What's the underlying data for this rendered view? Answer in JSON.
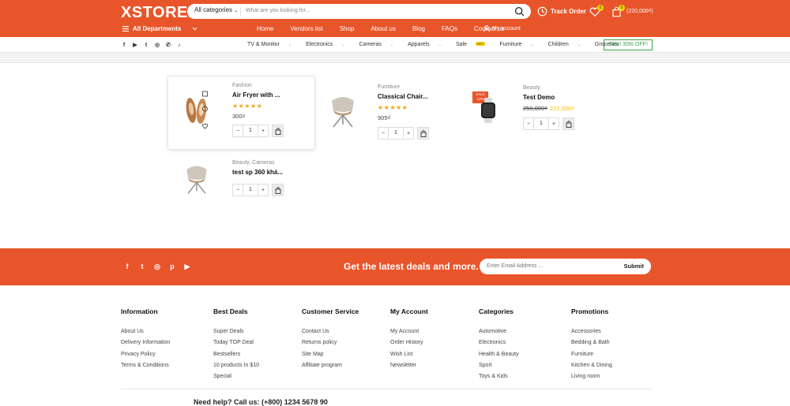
{
  "brand": {
    "logo": "XSTORE."
  },
  "search": {
    "category": "All categories",
    "placeholder": "What are you looking for..."
  },
  "header": {
    "track_order": "Track Order",
    "wishlist_count": "0",
    "cart_count": "0",
    "cart_total": "(220,000₫)",
    "all_departments": "All Departments",
    "nav": [
      "Home",
      "Vendors list",
      "Shop",
      "About us",
      "Blog",
      "FAQs",
      "Contact us"
    ],
    "my_account": "My account"
  },
  "categories": [
    "TV & Monitor",
    "Electronics",
    "Cameras",
    "Apparels",
    "Sale",
    "Furniture",
    "Children",
    "Groceries"
  ],
  "hot_badge": "HOT",
  "sale_banner": "Sale! 30% OFF!",
  "products": [
    {
      "category": "Fashion",
      "title": "Air Fryer with ...",
      "stars": "★★★★★",
      "price": "300₫",
      "qty": "1"
    },
    {
      "category": "Furniture",
      "title": "Classical Chair...",
      "stars": "★★★★★",
      "price": "905₫",
      "qty": "1"
    },
    {
      "category": "Beauty",
      "title": "Test Demo",
      "price_old": "250,000₫",
      "price_new": "222,000₫",
      "qty": "1",
      "sale_tag": "SALE",
      "sale_pct": "12%"
    },
    {
      "category": "Beauty, Cameras",
      "title": "test sp 360 khá...",
      "qty": "1"
    }
  ],
  "newsletter": {
    "title": "Get the latest deals and more.",
    "placeholder": "Enter Email Address ...",
    "submit": "Submit"
  },
  "footer": {
    "columns": [
      {
        "title": "Information",
        "items": [
          "About Us",
          "Delivery Information",
          "Privacy Policy",
          "Terms & Conditions"
        ]
      },
      {
        "title": "Best Deals",
        "items": [
          "Super Deals",
          "Today TOP Deal",
          "Bestsellers",
          "10 products In $10",
          "Special"
        ]
      },
      {
        "title": "Customer Service",
        "items": [
          "Contact Us",
          "Returns policy",
          "Site Map",
          "Affiliate program"
        ]
      },
      {
        "title": "My Account",
        "items": [
          "My Account",
          "Order History",
          "Wish List",
          "Newsletter"
        ]
      },
      {
        "title": "Categories",
        "items": [
          "Automotive",
          "Electronics",
          "Health & Beauty",
          "Sport",
          "Toys & Kids"
        ]
      },
      {
        "title": "Promotions",
        "items": [
          "Accessories",
          "Bedding & Bath",
          "Furniture",
          "Kitchen & Dining",
          "Living room"
        ]
      }
    ],
    "bottom_text": "Need help? Call us: (+800) 1234 5678 90"
  },
  "colors": {
    "accent": "#e8552a",
    "stars": "#f2a516",
    "sale_green": "#3aa14a"
  }
}
